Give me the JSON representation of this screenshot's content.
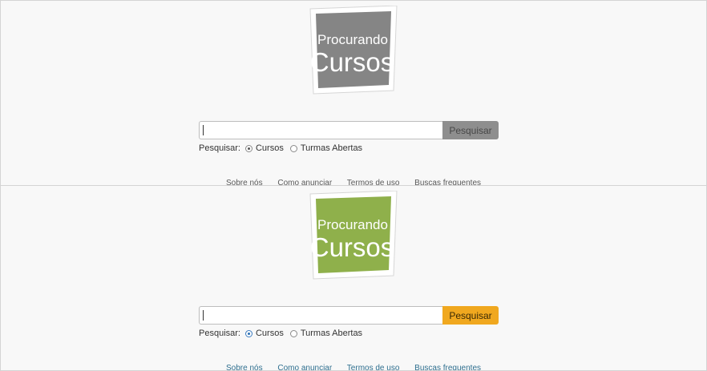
{
  "logo": {
    "line1": "Procurando",
    "line2": "Cursos"
  },
  "variants": [
    {
      "id": "gray",
      "logo_color": "#858585",
      "button_color": "#8e8e8e"
    },
    {
      "id": "color",
      "logo_color": "#8fb04b",
      "button_color": "#f0a81f"
    }
  ],
  "search": {
    "input_value": "",
    "button_label": "Pesquisar",
    "options_label": "Pesquisar:",
    "options": [
      "Cursos",
      "Turmas Abertas"
    ],
    "selected_option": "Cursos"
  },
  "footer": {
    "links": [
      "Sobre nós",
      "Como anunciar",
      "Termos de uso",
      "Buscas frequentes"
    ]
  }
}
